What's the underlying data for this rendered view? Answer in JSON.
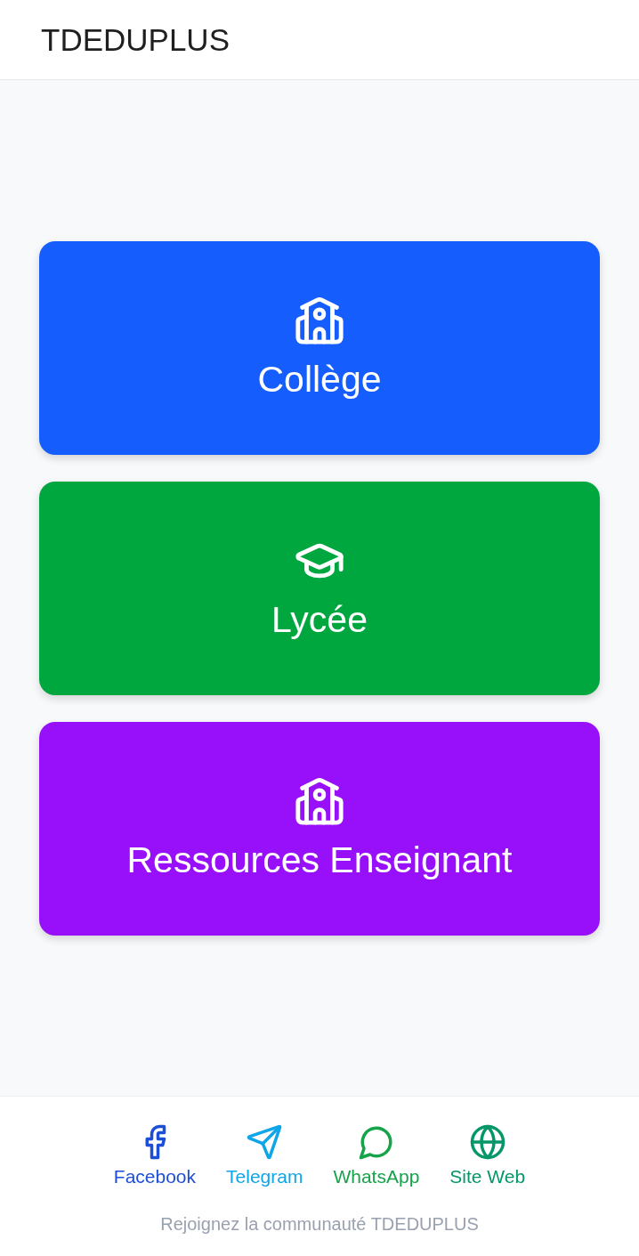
{
  "header": {
    "title": "TDEDUPLUS"
  },
  "cards": [
    {
      "label": "Collège",
      "kind": "school",
      "color": "#155dfc"
    },
    {
      "label": "Lycée",
      "kind": "graduation-cap",
      "color": "#00a63e"
    },
    {
      "label": "Ressources Enseignant",
      "kind": "school",
      "color": "#9810fa"
    }
  ],
  "footer": {
    "links": [
      {
        "label": "Facebook",
        "kind": "facebook",
        "color": "#1d4ed8"
      },
      {
        "label": "Telegram",
        "kind": "telegram",
        "color": "#0ea5e9"
      },
      {
        "label": "WhatsApp",
        "kind": "whatsapp",
        "color": "#16a34a"
      },
      {
        "label": "Site Web",
        "kind": "web",
        "color": "#059669"
      }
    ],
    "caption": "Rejoignez la communauté TDEDUPLUS"
  }
}
